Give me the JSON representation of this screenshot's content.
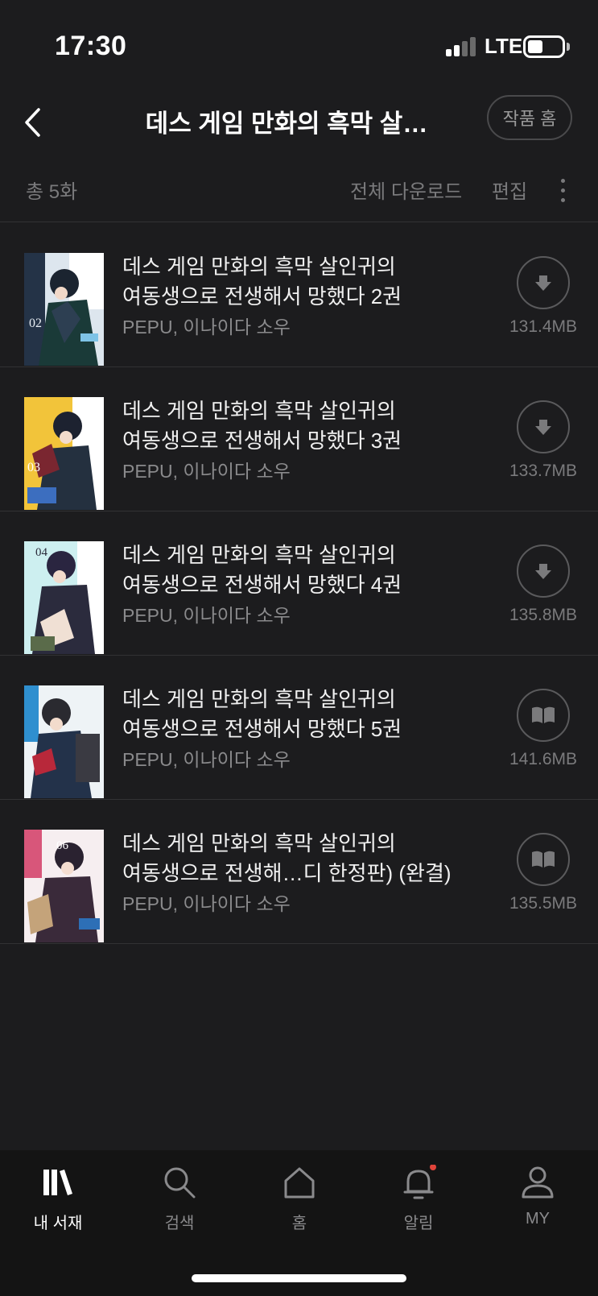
{
  "status_bar": {
    "time": "17:30",
    "network": "LTE"
  },
  "header": {
    "title": "데스 게임 만화의 흑막 살…",
    "work_home_button": "작품 홈"
  },
  "toolbar": {
    "count": "총 5화",
    "download_all": "전체 다운로드",
    "edit": "편집"
  },
  "items": [
    {
      "title_line1": "데스 게임 만화의 흑막 살인귀의",
      "title_line2": "여동생으로 전생해서 망했다 2권",
      "author": "PEPU, 이나이다 소우",
      "size": "131.4MB",
      "action_icon": "download-icon",
      "cover_number": "02"
    },
    {
      "title_line1": "데스 게임 만화의 흑막 살인귀의",
      "title_line2": "여동생으로 전생해서 망했다 3권",
      "author": "PEPU, 이나이다 소우",
      "size": "133.7MB",
      "action_icon": "download-icon",
      "cover_number": "03"
    },
    {
      "title_line1": "데스 게임 만화의 흑막 살인귀의",
      "title_line2": "여동생으로 전생해서 망했다 4권",
      "author": "PEPU, 이나이다 소우",
      "size": "135.8MB",
      "action_icon": "download-icon",
      "cover_number": "04"
    },
    {
      "title_line1": "데스 게임 만화의 흑막 살인귀의",
      "title_line2": "여동생으로 전생해서 망했다 5권",
      "author": "PEPU, 이나이다 소우",
      "size": "141.6MB",
      "action_icon": "read-book-icon",
      "cover_number": ""
    },
    {
      "title_line1": "데스 게임 만화의 흑막 살인귀의",
      "title_line2": "여동생으로 전생해…디 한정판) (완결)",
      "author": "PEPU, 이나이다 소우",
      "size": "135.5MB",
      "action_icon": "read-book-icon",
      "cover_number": "06"
    }
  ],
  "nav": {
    "library": "내 서재",
    "search": "검색",
    "home": "홈",
    "notifications": "알림",
    "my": "MY"
  },
  "colors": {
    "background": "#1c1c1e",
    "nav_background": "#141414",
    "notification_dot": "#e0443a",
    "muted_text": "#7a7a7c"
  }
}
